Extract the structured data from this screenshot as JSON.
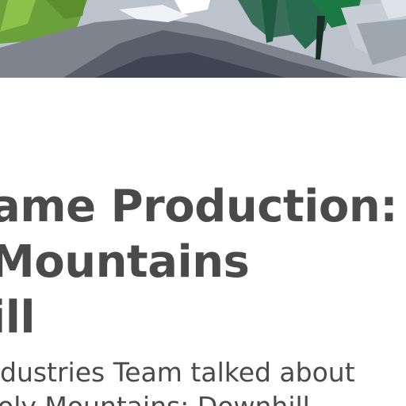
{
  "hero": {
    "image": "low-poly mountain landscape with trees",
    "colors": {
      "sky": "#d8dde4",
      "rock": "#7d8089",
      "shadow": "#4f5360",
      "grass": "#78ad3b",
      "tree": "#1f6b4a"
    }
  },
  "article": {
    "title_lines": [
      "ame Production:",
      "Mountains",
      "ill"
    ],
    "lead_lines": [
      "dustries Team talked about",
      "oly Mountains: Downhill"
    ]
  }
}
